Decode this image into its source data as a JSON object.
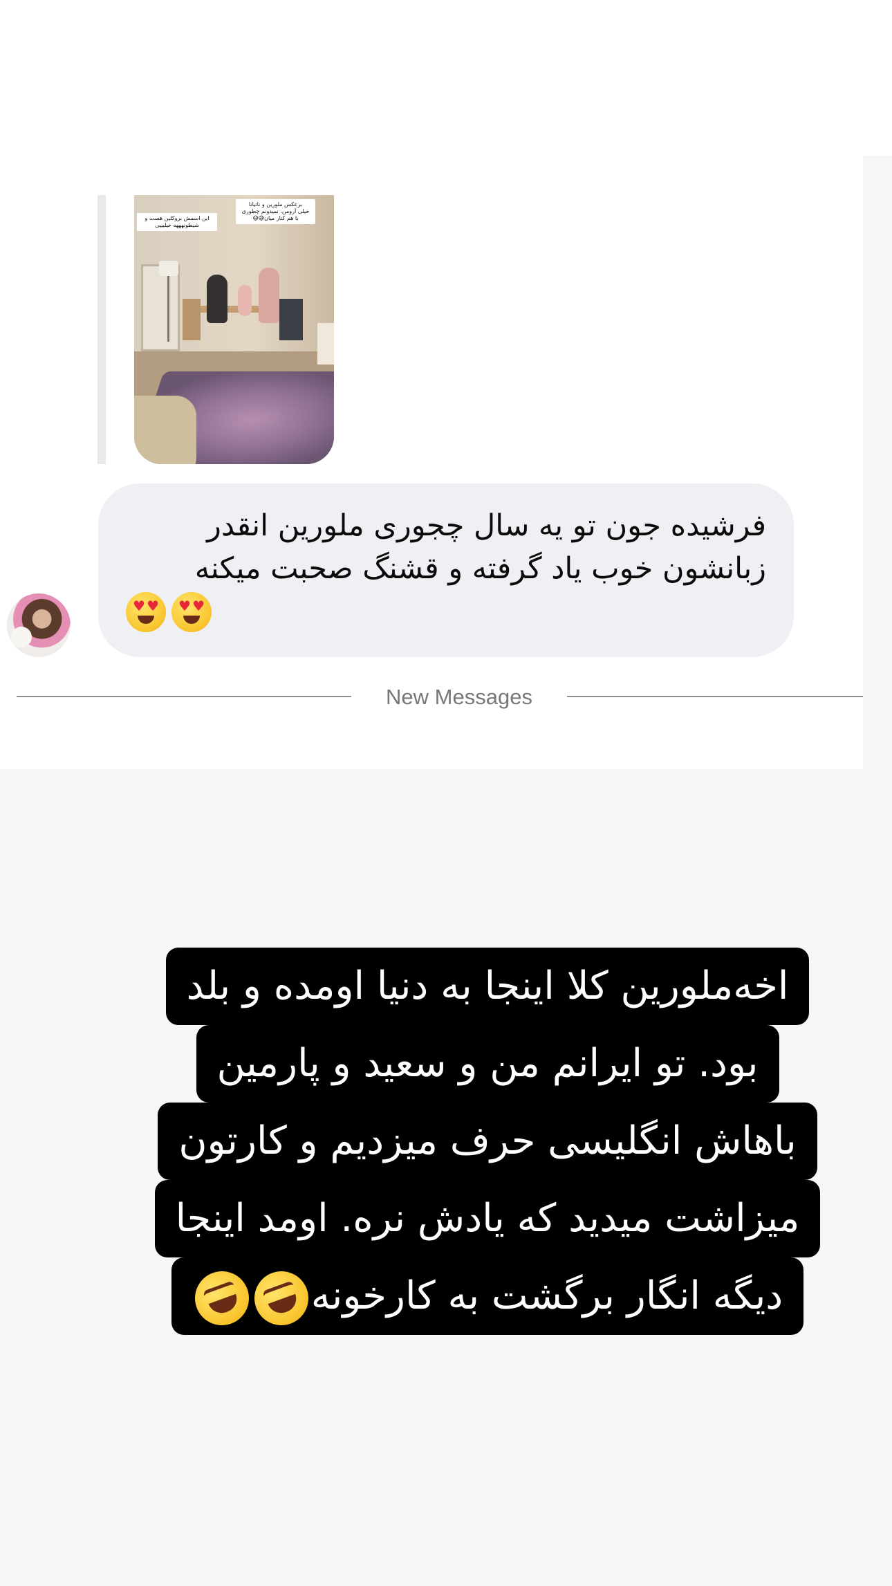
{
  "shared_post": {
    "caption_top": "برعکس ملورین و ناتیانا\nخیلی آرومن. نمیدونم چطوری\nبا هم کنار میان😅😅",
    "caption_left": "این اسمش بروکلین هست و\nشیطونهههه خیلیییی"
  },
  "message": {
    "text": "فرشیده جون تو یه سال چجوری ملورین انقدر\nزبانشون خوب یاد گرفته و قشنگ صحبت میکنه",
    "emojis": [
      "heart-eyes-emoji",
      "heart-eyes-emoji"
    ]
  },
  "divider": {
    "label": "New Messages"
  },
  "story_text": {
    "lines": [
      "اخه‌ملورین کلا اینجا به دنیا اومده و بلد",
      "بود. تو ایرانم من و سعید و پارمین",
      "باهاش انگلیسی حرف میزدیم و کارتون",
      "میزاشت میدید که یادش نره. اومد اینجا",
      "دیگه انگار برگشت به کارخونه"
    ],
    "emojis": [
      "rofl-emoji",
      "rofl-emoji"
    ]
  },
  "colors": {
    "bubble": "#eff0f4",
    "story_bg": "#000000",
    "story_fg": "#ffffff",
    "divider": "#8e8e93"
  }
}
